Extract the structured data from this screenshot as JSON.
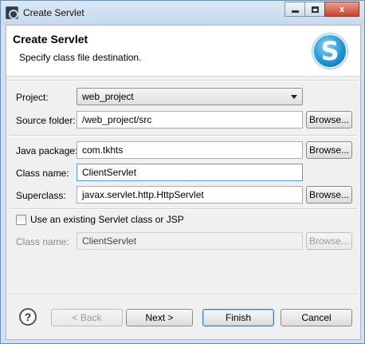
{
  "window": {
    "title": "Create Servlet",
    "close_label": "x"
  },
  "banner": {
    "title": "Create Servlet",
    "subtitle": "Specify class file destination.",
    "logo_letter": "S"
  },
  "form": {
    "project": {
      "label": "Project:",
      "value": "web_project"
    },
    "source_folder": {
      "label": "Source folder:",
      "value": "/web_project/src",
      "browse": "Browse..."
    },
    "java_package": {
      "label": "Java package:",
      "value": "com.tkhts",
      "browse": "Browse..."
    },
    "class_name": {
      "label": "Class name:",
      "value": "ClientServlet"
    },
    "superclass": {
      "label": "Superclass:",
      "value": "javax.servlet.http.HttpServlet",
      "browse": "Browse..."
    },
    "use_existing": {
      "label": "Use an existing Servlet class or JSP",
      "checked": false
    },
    "existing_class_name": {
      "label": "Class name:",
      "value": "ClientServlet",
      "browse": "Browse..."
    }
  },
  "buttons": {
    "help": "?",
    "back": "< Back",
    "next": "Next >",
    "finish": "Finish",
    "cancel": "Cancel"
  },
  "colors": {
    "accent": "#2196d6",
    "title_bar": "#c6d9ee",
    "close_button": "#c9432b"
  }
}
